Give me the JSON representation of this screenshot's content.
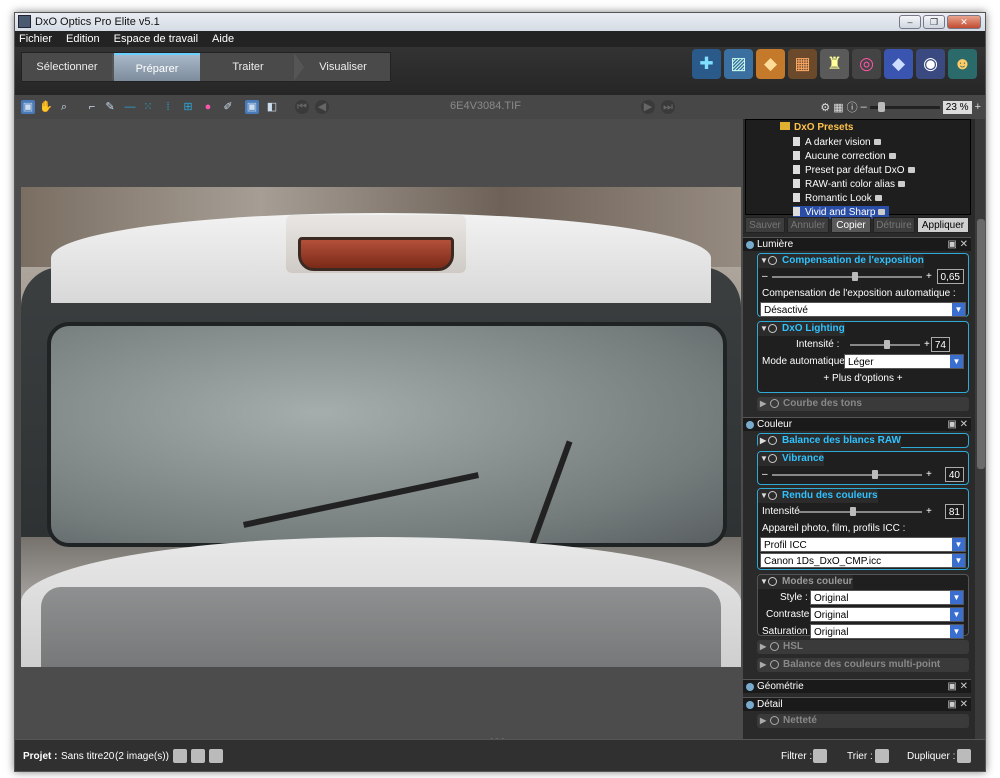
{
  "window": {
    "title": "DxO Optics Pro Elite v5.1"
  },
  "menu": [
    "Fichier",
    "Edition",
    "Espace de travail",
    "Aide"
  ],
  "steps": [
    "Sélectionner",
    "Préparer",
    "Traiter",
    "Visualiser"
  ],
  "active_step": "Préparer",
  "toolbar": {
    "filename": "6E4V3084.TIF",
    "zoom": "23 %"
  },
  "presets": {
    "folder": "DxO Presets",
    "items": [
      "A darker vision",
      "Aucune correction",
      "Preset par défaut DxO",
      "RAW-anti color alias",
      "Romantic Look",
      "Vivid and Sharp"
    ],
    "selected": "Vivid and Sharp",
    "buttons": {
      "save": "Sauver",
      "cancel": "Annuler",
      "copy": "Copier",
      "destroy": "Détruire",
      "apply": "Appliquer"
    }
  },
  "lumiere": {
    "title": "Lumière",
    "exposure": {
      "title": "Compensation de l'exposition",
      "value": "0,65",
      "auto_label": "Compensation de l'exposition automatique :",
      "auto_value": "Désactivé"
    },
    "lighting": {
      "title": "DxO Lighting",
      "intensity_label": "Intensité :",
      "intensity": "74",
      "mode_label": "Mode automatique :",
      "mode": "Léger",
      "more": "+ Plus d'options +"
    },
    "tone_curve": "Courbe des tons"
  },
  "couleur": {
    "title": "Couleur",
    "wb": "Balance des blancs RAW",
    "vibrance": {
      "title": "Vibrance",
      "value": "40"
    },
    "rendu": {
      "title": "Rendu des couleurs",
      "intensity_label": "Intensité",
      "intensity": "81",
      "camera_label": "Appareil photo, film, profils ICC :",
      "profile": "Profil ICC",
      "icc": "Canon 1Ds_DxO_CMP.icc"
    },
    "modes": {
      "title": "Modes couleur",
      "style_label": "Style :",
      "style": "Original",
      "contrast_label": "Contraste",
      "contrast": "Original",
      "saturation_label": "Saturation :",
      "saturation": "Original"
    },
    "hsl": "HSL",
    "multipoint": "Balance des couleurs multi-point"
  },
  "geometrie": {
    "title": "Géométrie"
  },
  "detail": {
    "title": "Détail",
    "nettete": "Netteté"
  },
  "status": {
    "project_label": "Projet :",
    "project": "Sans titre20",
    "count": "(2 image(s))",
    "filter": "Filtrer :",
    "sort": "Trier :",
    "duplicate": "Dupliquer :"
  }
}
